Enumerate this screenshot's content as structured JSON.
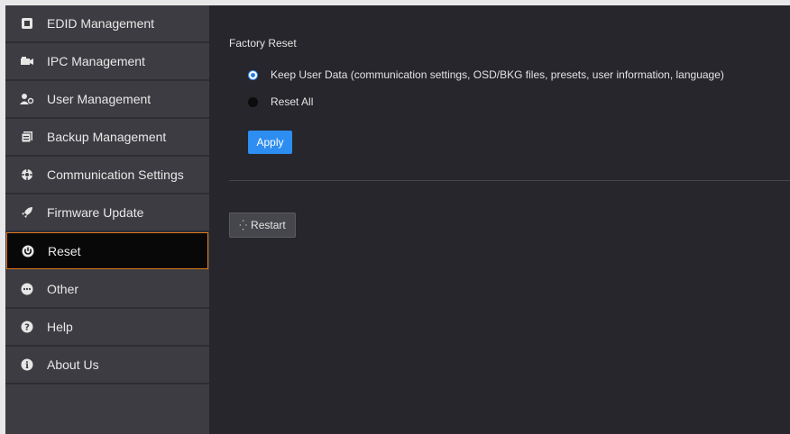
{
  "sidebar": {
    "items": [
      {
        "label": "EDID Management",
        "icon": "edid-icon"
      },
      {
        "label": "IPC Management",
        "icon": "camera-icon"
      },
      {
        "label": "User Management",
        "icon": "user-icon"
      },
      {
        "label": "Backup Management",
        "icon": "backup-icon"
      },
      {
        "label": "Communication Settings",
        "icon": "communication-icon"
      },
      {
        "label": "Firmware Update",
        "icon": "rocket-icon"
      },
      {
        "label": "Reset",
        "icon": "power-icon",
        "active": true
      },
      {
        "label": "Other",
        "icon": "other-icon"
      },
      {
        "label": "Help",
        "icon": "help-icon"
      },
      {
        "label": "About Us",
        "icon": "info-icon"
      }
    ]
  },
  "main": {
    "section_title": "Factory Reset",
    "options": [
      {
        "label": "Keep User Data (communication settings, OSD/BKG files, presets, user information, language)",
        "checked": true
      },
      {
        "label": "Reset All",
        "checked": false
      }
    ],
    "apply_label": "Apply",
    "restart_label": "Restart"
  },
  "colors": {
    "accent": "#2d8df0",
    "active_border": "#e07a1f",
    "sidebar_bg": "#3c3c42",
    "main_bg": "#26262c"
  }
}
